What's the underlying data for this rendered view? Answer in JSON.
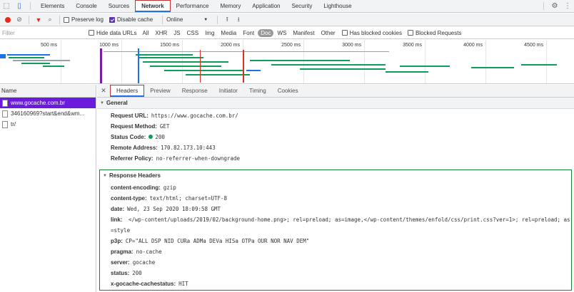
{
  "tabs": [
    "Elements",
    "Console",
    "Sources",
    "Network",
    "Performance",
    "Memory",
    "Application",
    "Security",
    "Lighthouse"
  ],
  "toolbar": {
    "preserve_log": "Preserve log",
    "disable_cache": "Disable cache",
    "throttle": "Online"
  },
  "filter": {
    "placeholder": "Filter",
    "hide_data_urls": "Hide data URLs",
    "types": [
      "All",
      "XHR",
      "JS",
      "CSS",
      "Img",
      "Media",
      "Font",
      "Doc",
      "WS",
      "Manifest",
      "Other"
    ],
    "selected_type": "Doc",
    "has_blocked": "Has blocked cookies",
    "blocked_requests": "Blocked Requests"
  },
  "overview": {
    "ticks": [
      "500 ms",
      "1000 ms",
      "1500 ms",
      "2000 ms",
      "2500 ms",
      "3000 ms",
      "3500 ms",
      "4000 ms",
      "4500 ms"
    ]
  },
  "requests": {
    "header": "Name",
    "items": [
      "www.gocache.com.br",
      "346160969?start&end&wm...",
      "tr/"
    ]
  },
  "detail": {
    "tabs": [
      "Headers",
      "Preview",
      "Response",
      "Initiator",
      "Timing",
      "Cookies"
    ],
    "general": {
      "title": "General",
      "rows": [
        {
          "k": "Request URL:",
          "v": "https://www.gocache.com.br/"
        },
        {
          "k": "Request Method:",
          "v": "GET"
        },
        {
          "k": "Status Code:",
          "v": "200"
        },
        {
          "k": "Remote Address:",
          "v": "170.82.173.10:443"
        },
        {
          "k": "Referrer Policy:",
          "v": "no-referrer-when-downgrade"
        }
      ]
    },
    "response": {
      "title": "Response Headers",
      "rows": [
        {
          "k": "content-encoding:",
          "v": "gzip"
        },
        {
          "k": "content-type:",
          "v": "text/html; charset=UTF-8"
        },
        {
          "k": "date:",
          "v": "Wed, 23 Sep 2020 18:09:58 GMT"
        },
        {
          "k": "link:",
          "v": "</wp-content/uploads/2019/02/background-home.png>; rel=preload; as=image,</wp-content/themes/enfold/css/print.css?ver=1>; rel=preload; as=style"
        },
        {
          "k": "p3p:",
          "v": "CP=\"ALL DSP NID CURa ADMa DEVa HISa OTPa OUR NOR NAV DEM\""
        },
        {
          "k": "pragma:",
          "v": "no-cache"
        },
        {
          "k": "server:",
          "v": "gocache"
        },
        {
          "k": "status:",
          "v": "200"
        },
        {
          "k": "x-gocache-cachestatus:",
          "v": "HIT"
        }
      ]
    }
  }
}
